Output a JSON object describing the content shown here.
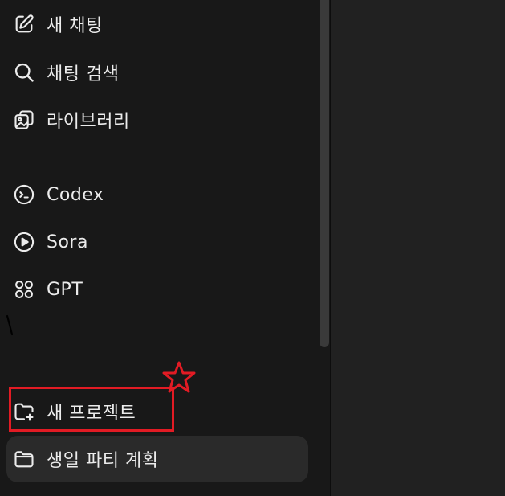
{
  "sidebar": {
    "items": [
      {
        "label": "새 채팅",
        "icon": "edit-icon"
      },
      {
        "label": "채팅 검색",
        "icon": "search-icon"
      },
      {
        "label": "라이브러리",
        "icon": "library-icon"
      },
      {
        "label": "Codex",
        "icon": "codex-icon"
      },
      {
        "label": "Sora",
        "icon": "sora-icon"
      },
      {
        "label": "GPT",
        "icon": "gpt-icon"
      }
    ],
    "projects": [
      {
        "label": "새 프로젝트",
        "icon": "folder-plus-icon"
      },
      {
        "label": "생일 파티 계획",
        "icon": "folder-icon",
        "selected": true
      }
    ]
  },
  "annotations": {
    "highlight_color": "#e21b24"
  },
  "colors": {
    "sidebar_bg": "#181818",
    "main_bg": "#212121",
    "text": "#ececec",
    "selected_bg": "#2a2a2a"
  }
}
